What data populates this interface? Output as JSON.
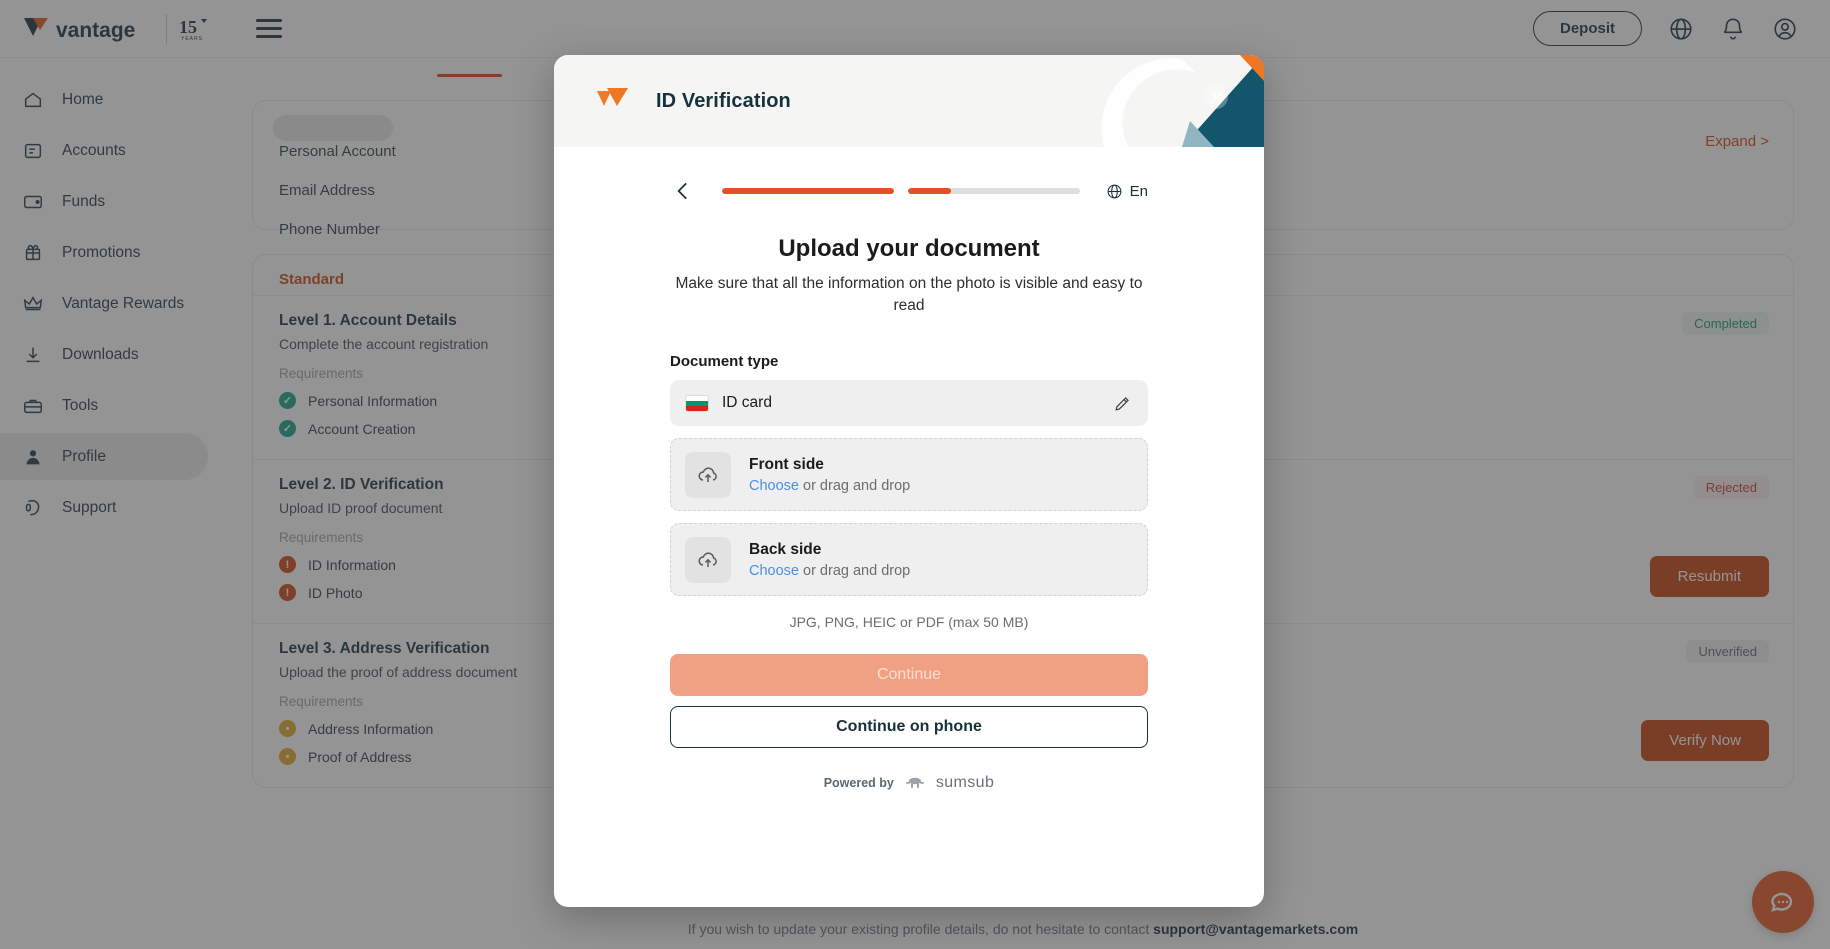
{
  "topbar": {
    "logo_text": "vantage",
    "logo_badge": "15",
    "logo_badge_sub": "YEARS",
    "menu_icon": "hamburger-icon",
    "deposit_label": "Deposit",
    "icons": [
      "globe-icon",
      "bell-icon",
      "account-icon"
    ]
  },
  "sidebar": {
    "items": [
      {
        "label": "Home",
        "icon": "home-icon",
        "active": false
      },
      {
        "label": "Accounts",
        "icon": "accounts-icon",
        "active": false
      },
      {
        "label": "Funds",
        "icon": "funds-icon",
        "active": false
      },
      {
        "label": "Promotions",
        "icon": "gift-icon",
        "active": false
      },
      {
        "label": "Vantage Rewards",
        "icon": "crown-icon",
        "active": false
      },
      {
        "label": "Downloads",
        "icon": "download-icon",
        "active": false
      },
      {
        "label": "Tools",
        "icon": "toolbox-icon",
        "active": false
      },
      {
        "label": "Profile",
        "icon": "person-icon",
        "active": true
      },
      {
        "label": "Support",
        "icon": "headset-icon",
        "active": false
      }
    ]
  },
  "main": {
    "expand_label": "Expand >",
    "profile_fields": [
      {
        "label": "Personal Account"
      },
      {
        "label": "Email Address"
      },
      {
        "label": "Phone Number"
      }
    ],
    "standard_label": "Standard",
    "levels": [
      {
        "title": "Level 1. Account Details",
        "subtitle": "Complete the account registration",
        "requirements_label": "Requirements",
        "requirements": [
          {
            "label": "Personal Information",
            "state": "done"
          },
          {
            "label": "Account Creation",
            "state": "done"
          }
        ],
        "badge": "Completed",
        "badge_state": "completed",
        "action": null
      },
      {
        "title": "Level 2. ID Verification",
        "subtitle": "Upload ID proof document",
        "requirements_label": "Requirements",
        "requirements": [
          {
            "label": "ID Information",
            "state": "error"
          },
          {
            "label": "ID Photo",
            "state": "error"
          }
        ],
        "badge": "Rejected",
        "badge_state": "rejected",
        "action": "Resubmit"
      },
      {
        "title": "Level 3. Address Verification",
        "subtitle": "Upload the proof of address document",
        "requirements_label": "Requirements",
        "requirements": [
          {
            "label": "Address Information",
            "state": "waiting"
          },
          {
            "label": "Proof of Address",
            "state": "waiting"
          }
        ],
        "badge": "Unverified",
        "badge_state": "unverified",
        "action": "Verify Now"
      }
    ],
    "footnote_text": "If you wish to update your existing profile details, do not hesitate to contact ",
    "footnote_email": "support@vantagemarkets.com",
    "chat_icon": "chat-bubble-icon"
  },
  "modal": {
    "title": "ID Verification",
    "logo_icon": "vantage-arrow-icon",
    "close_icon": "close-icon",
    "back_icon": "chevron-left-icon",
    "progress": [
      {
        "percent": 100
      },
      {
        "percent": 25
      }
    ],
    "language": {
      "label": "En",
      "icon": "globe-icon"
    },
    "heading": "Upload your document",
    "description": "Make sure that all the information on the photo is visible and easy to read",
    "document_type_label": "Document type",
    "document_type_value": "ID card",
    "document_type_flag": "bulgaria-flag",
    "edit_icon": "pencil-icon",
    "uploads": [
      {
        "title": "Front side",
        "choose": "Choose",
        "rest": " or drag and drop",
        "icon": "cloud-upload-icon"
      },
      {
        "title": "Back side",
        "choose": "Choose",
        "rest": " or drag and drop",
        "icon": "cloud-upload-icon"
      }
    ],
    "formats": "JPG, PNG, HEIC or PDF (max 50 MB)",
    "continue_label": "Continue",
    "continue_phone_label": "Continue on phone",
    "powered_by": "Powered by",
    "powered_brand": "sumsub"
  },
  "colors": {
    "accent_orange": "#df5327",
    "brand_dark": "#17323d",
    "link_blue": "#4a90e2",
    "success": "#14a085",
    "error": "#d1460f",
    "waiting": "#e0a924"
  }
}
